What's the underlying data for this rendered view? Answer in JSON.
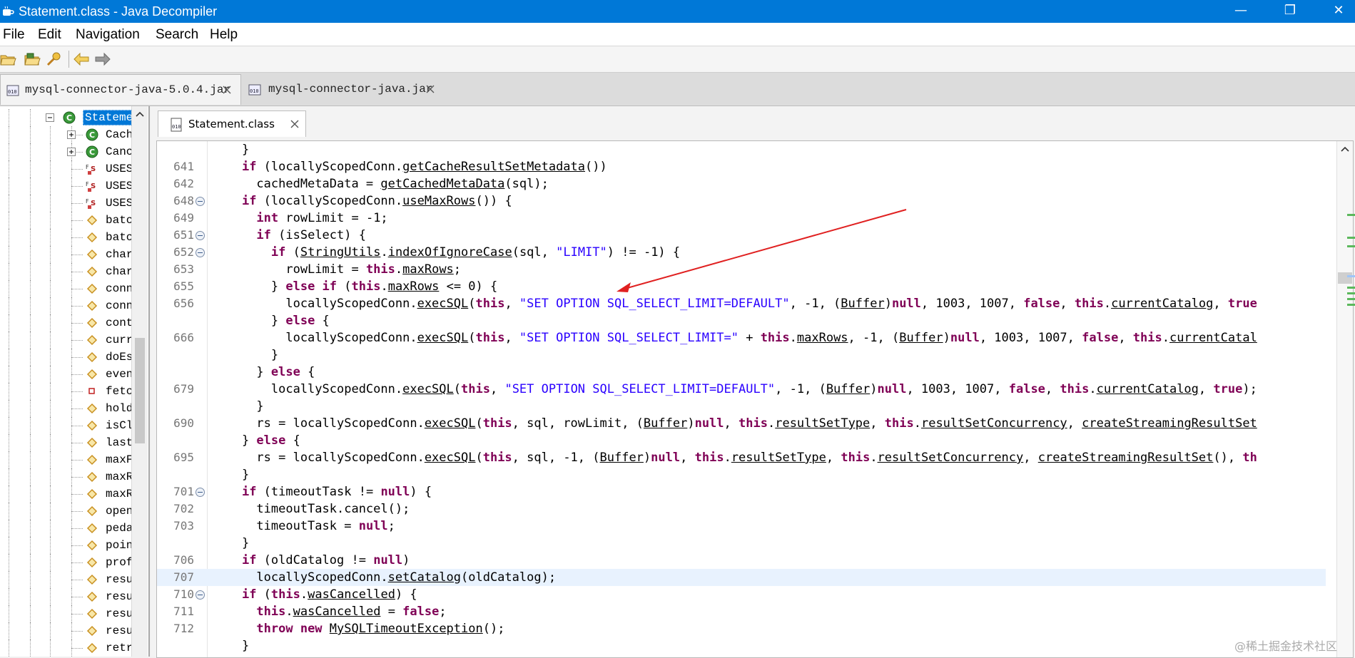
{
  "window": {
    "title": "Statement.class - Java Decompiler",
    "controls": {
      "minimize": "—",
      "maximize": "❐",
      "close": "✕"
    }
  },
  "menu": [
    "File",
    "Edit",
    "Navigation",
    "Search",
    "Help"
  ],
  "toolbar": {
    "icons": [
      "open-file-icon",
      "open-type-icon",
      "search-icon",
      "back-icon",
      "forward-icon"
    ]
  },
  "file_tabs": [
    {
      "label": "mysql-connector-java-5.0.4.jar",
      "active": true
    },
    {
      "label": "mysql-connector-java.jar",
      "active": false
    }
  ],
  "tree": {
    "selected_label": "Stateme",
    "items": [
      {
        "label": "Stateme",
        "icon": "class-icon",
        "selected": true
      },
      {
        "label": "Cach",
        "icon": "inner-class-icon"
      },
      {
        "label": "Canc",
        "icon": "inner-class-icon"
      },
      {
        "label": "USES",
        "icon": "static-final-field-icon"
      },
      {
        "label": "USES",
        "icon": "static-final-field-icon"
      },
      {
        "label": "USES",
        "icon": "static-final-field-icon"
      },
      {
        "label": "batc",
        "icon": "field-icon"
      },
      {
        "label": "batc",
        "icon": "field-icon"
      },
      {
        "label": "char",
        "icon": "field-icon"
      },
      {
        "label": "char",
        "icon": "field-icon"
      },
      {
        "label": "conn",
        "icon": "field-icon"
      },
      {
        "label": "conn",
        "icon": "field-icon"
      },
      {
        "label": "cont",
        "icon": "field-icon"
      },
      {
        "label": "curr",
        "icon": "field-icon"
      },
      {
        "label": "doEs",
        "icon": "field-icon"
      },
      {
        "label": "even",
        "icon": "field-icon"
      },
      {
        "label": "fetc",
        "icon": "private-field-icon"
      },
      {
        "label": "hold",
        "icon": "field-icon"
      },
      {
        "label": "isCl",
        "icon": "field-icon"
      },
      {
        "label": "last",
        "icon": "field-icon"
      },
      {
        "label": "maxF",
        "icon": "field-icon"
      },
      {
        "label": "maxR",
        "icon": "field-icon"
      },
      {
        "label": "maxR",
        "icon": "field-icon"
      },
      {
        "label": "open",
        "icon": "field-icon"
      },
      {
        "label": "peda",
        "icon": "field-icon"
      },
      {
        "label": "poin",
        "icon": "field-icon"
      },
      {
        "label": "prof",
        "icon": "field-icon"
      },
      {
        "label": "resu",
        "icon": "field-icon"
      },
      {
        "label": "resu",
        "icon": "field-icon"
      },
      {
        "label": "resu",
        "icon": "field-icon"
      },
      {
        "label": "resu",
        "icon": "field-icon"
      },
      {
        "label": "retr",
        "icon": "field-icon"
      }
    ]
  },
  "editor": {
    "tab_label": "Statement.class",
    "lines": [
      {
        "n": "",
        "fold": false,
        "segs": [
          [
            "    }",
            ""
          ]
        ]
      },
      {
        "n": "641",
        "fold": false,
        "segs": [
          [
            "    ",
            ""
          ],
          [
            "if",
            "kw"
          ],
          [
            " (locallyScopedConn.",
            ""
          ],
          [
            "getCacheResultSetMetadata",
            "ul"
          ],
          [
            "())",
            ""
          ]
        ]
      },
      {
        "n": "642",
        "fold": false,
        "segs": [
          [
            "      cachedMetaData = ",
            ""
          ],
          [
            "getCachedMetaData",
            "ul"
          ],
          [
            "(sql);",
            ""
          ]
        ]
      },
      {
        "n": "648",
        "fold": true,
        "segs": [
          [
            "    ",
            ""
          ],
          [
            "if",
            "kw"
          ],
          [
            " (locallyScopedConn.",
            ""
          ],
          [
            "useMaxRows",
            "ul"
          ],
          [
            "()) {",
            ""
          ]
        ]
      },
      {
        "n": "649",
        "fold": false,
        "segs": [
          [
            "      ",
            ""
          ],
          [
            "int",
            "kw"
          ],
          [
            " rowLimit = -1;",
            ""
          ]
        ]
      },
      {
        "n": "651",
        "fold": true,
        "segs": [
          [
            "      ",
            ""
          ],
          [
            "if",
            "kw"
          ],
          [
            " (isSelect) {",
            ""
          ]
        ]
      },
      {
        "n": "652",
        "fold": true,
        "segs": [
          [
            "        ",
            ""
          ],
          [
            "if",
            "kw"
          ],
          [
            " (",
            ""
          ],
          [
            "StringUtils",
            "ul"
          ],
          [
            ".",
            ""
          ],
          [
            "indexOfIgnoreCase",
            "ul"
          ],
          [
            "(sql, ",
            ""
          ],
          [
            "\"LIMIT\"",
            "str"
          ],
          [
            ") != -1) {",
            ""
          ]
        ]
      },
      {
        "n": "653",
        "fold": false,
        "segs": [
          [
            "          rowLimit = ",
            ""
          ],
          [
            "this",
            "kw"
          ],
          [
            ".",
            ""
          ],
          [
            "maxRows",
            "ul"
          ],
          [
            ";",
            ""
          ]
        ]
      },
      {
        "n": "655",
        "fold": false,
        "segs": [
          [
            "        } ",
            ""
          ],
          [
            "else if",
            "kw"
          ],
          [
            " (",
            ""
          ],
          [
            "this",
            "kw"
          ],
          [
            ".",
            ""
          ],
          [
            "maxRows",
            "ul"
          ],
          [
            " <= 0) {",
            ""
          ]
        ]
      },
      {
        "n": "656",
        "fold": false,
        "segs": [
          [
            "          locallyScopedConn.",
            ""
          ],
          [
            "execSQL",
            "ul"
          ],
          [
            "(",
            ""
          ],
          [
            "this",
            "kw"
          ],
          [
            ", ",
            ""
          ],
          [
            "\"SET OPTION SQL_SELECT_LIMIT=DEFAULT\"",
            "str"
          ],
          [
            ", -1, (",
            ""
          ],
          [
            "Buffer",
            "ul"
          ],
          [
            ")",
            ""
          ],
          [
            "null",
            "kw"
          ],
          [
            ", 1003, 1007, ",
            ""
          ],
          [
            "false",
            "kw"
          ],
          [
            ", ",
            ""
          ],
          [
            "this",
            "kw"
          ],
          [
            ".",
            ""
          ],
          [
            "currentCatalog",
            "ul"
          ],
          [
            ", ",
            ""
          ],
          [
            "true",
            "kw"
          ]
        ]
      },
      {
        "n": "",
        "fold": false,
        "segs": [
          [
            "        } ",
            ""
          ],
          [
            "else",
            "kw"
          ],
          [
            " {",
            ""
          ]
        ]
      },
      {
        "n": "666",
        "fold": false,
        "segs": [
          [
            "          locallyScopedConn.",
            ""
          ],
          [
            "execSQL",
            "ul"
          ],
          [
            "(",
            ""
          ],
          [
            "this",
            "kw"
          ],
          [
            ", ",
            ""
          ],
          [
            "\"SET OPTION SQL_SELECT_LIMIT=\"",
            "str"
          ],
          [
            " + ",
            ""
          ],
          [
            "this",
            "kw"
          ],
          [
            ".",
            ""
          ],
          [
            "maxRows",
            "ul"
          ],
          [
            ", -1, (",
            ""
          ],
          [
            "Buffer",
            "ul"
          ],
          [
            ")",
            ""
          ],
          [
            "null",
            "kw"
          ],
          [
            ", 1003, 1007, ",
            ""
          ],
          [
            "false",
            "kw"
          ],
          [
            ", ",
            ""
          ],
          [
            "this",
            "kw"
          ],
          [
            ".",
            ""
          ],
          [
            "currentCatal",
            "ul"
          ]
        ]
      },
      {
        "n": "",
        "fold": false,
        "segs": [
          [
            "        }",
            ""
          ]
        ]
      },
      {
        "n": "",
        "fold": false,
        "segs": [
          [
            "      } ",
            ""
          ],
          [
            "else",
            "kw"
          ],
          [
            " {",
            ""
          ]
        ]
      },
      {
        "n": "679",
        "fold": false,
        "segs": [
          [
            "        locallyScopedConn.",
            ""
          ],
          [
            "execSQL",
            "ul"
          ],
          [
            "(",
            ""
          ],
          [
            "this",
            "kw"
          ],
          [
            ", ",
            ""
          ],
          [
            "\"SET OPTION SQL_SELECT_LIMIT=DEFAULT\"",
            "str"
          ],
          [
            ", -1, (",
            ""
          ],
          [
            "Buffer",
            "ul"
          ],
          [
            ")",
            ""
          ],
          [
            "null",
            "kw"
          ],
          [
            ", 1003, 1007, ",
            ""
          ],
          [
            "false",
            "kw"
          ],
          [
            ", ",
            ""
          ],
          [
            "this",
            "kw"
          ],
          [
            ".",
            ""
          ],
          [
            "currentCatalog",
            "ul"
          ],
          [
            ", ",
            ""
          ],
          [
            "true",
            "kw"
          ],
          [
            ");",
            ""
          ]
        ]
      },
      {
        "n": "",
        "fold": false,
        "segs": [
          [
            "      }",
            ""
          ]
        ]
      },
      {
        "n": "690",
        "fold": false,
        "segs": [
          [
            "      rs = locallyScopedConn.",
            ""
          ],
          [
            "execSQL",
            "ul"
          ],
          [
            "(",
            ""
          ],
          [
            "this",
            "kw"
          ],
          [
            ", sql, rowLimit, (",
            ""
          ],
          [
            "Buffer",
            "ul"
          ],
          [
            ")",
            ""
          ],
          [
            "null",
            "kw"
          ],
          [
            ", ",
            ""
          ],
          [
            "this",
            "kw"
          ],
          [
            ".",
            ""
          ],
          [
            "resultSetType",
            "ul"
          ],
          [
            ", ",
            ""
          ],
          [
            "this",
            "kw"
          ],
          [
            ".",
            ""
          ],
          [
            "resultSetConcurrency",
            "ul"
          ],
          [
            ", ",
            ""
          ],
          [
            "createStreamingResultSet",
            "ul"
          ]
        ]
      },
      {
        "n": "",
        "fold": false,
        "segs": [
          [
            "    } ",
            ""
          ],
          [
            "else",
            "kw"
          ],
          [
            " {",
            ""
          ]
        ]
      },
      {
        "n": "695",
        "fold": false,
        "segs": [
          [
            "      rs = locallyScopedConn.",
            ""
          ],
          [
            "execSQL",
            "ul"
          ],
          [
            "(",
            ""
          ],
          [
            "this",
            "kw"
          ],
          [
            ", sql, -1, (",
            ""
          ],
          [
            "Buffer",
            "ul"
          ],
          [
            ")",
            ""
          ],
          [
            "null",
            "kw"
          ],
          [
            ", ",
            ""
          ],
          [
            "this",
            "kw"
          ],
          [
            ".",
            ""
          ],
          [
            "resultSetType",
            "ul"
          ],
          [
            ", ",
            ""
          ],
          [
            "this",
            "kw"
          ],
          [
            ".",
            ""
          ],
          [
            "resultSetConcurrency",
            "ul"
          ],
          [
            ", ",
            ""
          ],
          [
            "createStreamingResultSet",
            "ul"
          ],
          [
            "(), ",
            ""
          ],
          [
            "th",
            "kw"
          ]
        ]
      },
      {
        "n": "",
        "fold": false,
        "segs": [
          [
            "    }",
            ""
          ]
        ]
      },
      {
        "n": "701",
        "fold": true,
        "segs": [
          [
            "    ",
            ""
          ],
          [
            "if",
            "kw"
          ],
          [
            " (timeoutTask != ",
            ""
          ],
          [
            "null",
            "kw"
          ],
          [
            ") {",
            ""
          ]
        ]
      },
      {
        "n": "702",
        "fold": false,
        "segs": [
          [
            "      timeoutTask.cancel();",
            ""
          ]
        ]
      },
      {
        "n": "703",
        "fold": false,
        "segs": [
          [
            "      timeoutTask = ",
            ""
          ],
          [
            "null",
            "kw"
          ],
          [
            ";",
            ""
          ]
        ]
      },
      {
        "n": "",
        "fold": false,
        "segs": [
          [
            "    }",
            ""
          ]
        ]
      },
      {
        "n": "706",
        "fold": false,
        "segs": [
          [
            "    ",
            ""
          ],
          [
            "if",
            "kw"
          ],
          [
            " (oldCatalog != ",
            ""
          ],
          [
            "null",
            "kw"
          ],
          [
            ")",
            ""
          ]
        ]
      },
      {
        "n": "707",
        "fold": false,
        "hl": true,
        "segs": [
          [
            "      locallyScopedConn.",
            ""
          ],
          [
            "setCatalog",
            "ul"
          ],
          [
            "(oldCatalog);",
            ""
          ]
        ]
      },
      {
        "n": "710",
        "fold": true,
        "segs": [
          [
            "    ",
            ""
          ],
          [
            "if",
            "kw"
          ],
          [
            " (",
            ""
          ],
          [
            "this",
            "kw"
          ],
          [
            ".",
            ""
          ],
          [
            "wasCancelled",
            "ul"
          ],
          [
            ") {",
            ""
          ]
        ]
      },
      {
        "n": "711",
        "fold": false,
        "segs": [
          [
            "      ",
            ""
          ],
          [
            "this",
            "kw"
          ],
          [
            ".",
            ""
          ],
          [
            "wasCancelled",
            "ul"
          ],
          [
            " = ",
            ""
          ],
          [
            "false",
            "kw"
          ],
          [
            ";",
            ""
          ]
        ]
      },
      {
        "n": "712",
        "fold": false,
        "segs": [
          [
            "      ",
            ""
          ],
          [
            "throw new",
            "kw"
          ],
          [
            " ",
            ""
          ],
          [
            "MySQLTimeoutException",
            "ul"
          ],
          [
            "();",
            ""
          ]
        ]
      },
      {
        "n": "",
        "fold": false,
        "segs": [
          [
            "    }",
            ""
          ]
        ]
      }
    ]
  },
  "annotation": {
    "color": "#e02020"
  },
  "watermark": "@稀土掘金技术社区",
  "colors": {
    "titlebar": "#0078d7",
    "keyword": "#7f0055",
    "string": "#2a00ff",
    "selection": "#0078d7"
  }
}
